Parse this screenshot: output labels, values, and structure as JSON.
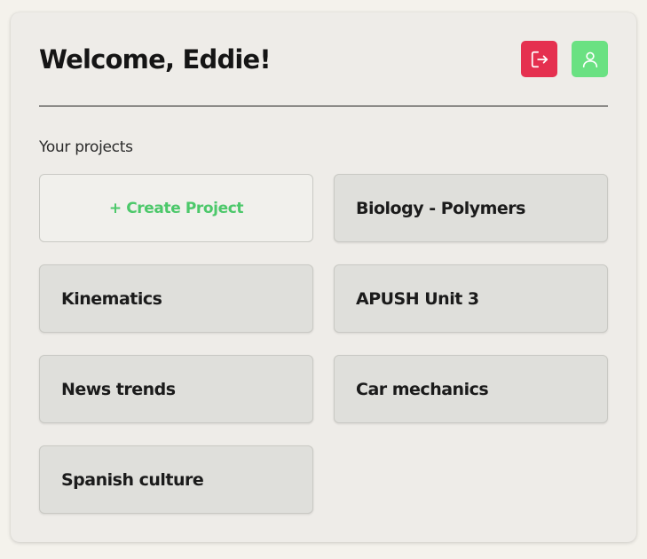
{
  "header": {
    "title": "Welcome, Eddie!",
    "logout_icon": "logout-icon",
    "profile_icon": "user-icon"
  },
  "colors": {
    "logout_button": "#e5304f",
    "profile_button": "#6ae182",
    "create_project_text": "#4cc86a"
  },
  "projects_section": {
    "label": "Your projects",
    "create_label": "+ Create Project",
    "projects": [
      {
        "name": "Biology - Polymers"
      },
      {
        "name": "Kinematics"
      },
      {
        "name": "APUSH Unit 3"
      },
      {
        "name": "News trends"
      },
      {
        "name": "Car mechanics"
      },
      {
        "name": "Spanish culture"
      }
    ]
  }
}
